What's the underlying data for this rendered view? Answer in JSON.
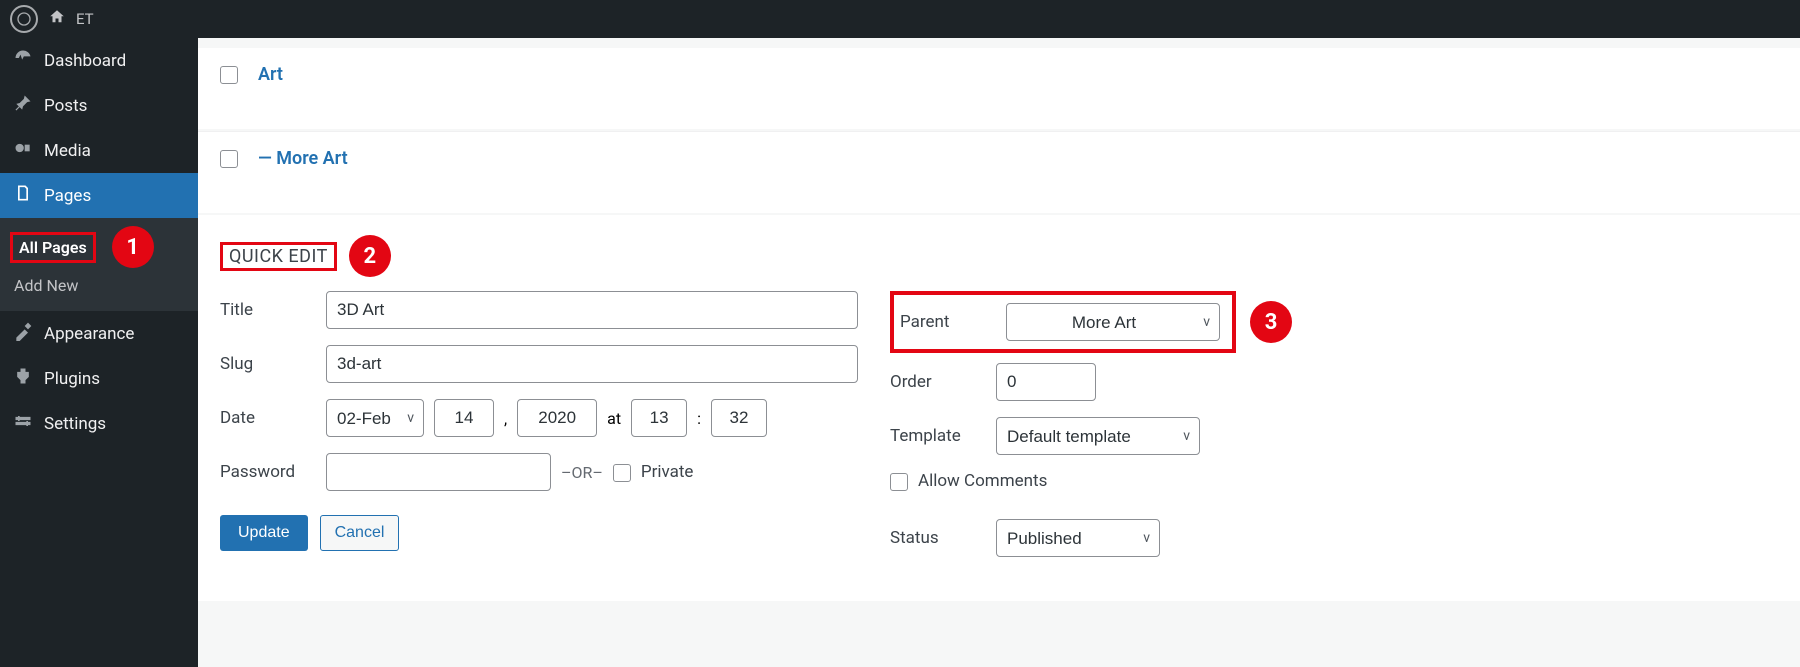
{
  "topbar": {
    "site_name": "ET"
  },
  "sidebar": {
    "dashboard": "Dashboard",
    "posts": "Posts",
    "media": "Media",
    "pages": "Pages",
    "all_pages": "All Pages",
    "add_new": "Add New",
    "appearance": "Appearance",
    "plugins": "Plugins",
    "settings": "Settings"
  },
  "annotations": {
    "one": "1",
    "two": "2",
    "three": "3"
  },
  "rows": {
    "art": "Art",
    "more_art": "— More Art"
  },
  "quick_edit": {
    "heading": "QUICK EDIT",
    "title_label": "Title",
    "title_value": "3D Art",
    "slug_label": "Slug",
    "slug_value": "3d-art",
    "date_label": "Date",
    "month": "02-Feb",
    "day": "14",
    "year": "2020",
    "at": "at",
    "hour": "13",
    "minute": "32",
    "password_label": "Password",
    "password_value": "",
    "or": "–OR–",
    "private_label": "Private",
    "parent_label": "Parent",
    "parent_value": "More Art",
    "order_label": "Order",
    "order_value": "0",
    "template_label": "Template",
    "template_value": "Default template",
    "allow_comments": "Allow Comments",
    "status_label": "Status",
    "status_value": "Published",
    "update": "Update",
    "cancel": "Cancel",
    "comma": ",",
    "colon": ":"
  }
}
